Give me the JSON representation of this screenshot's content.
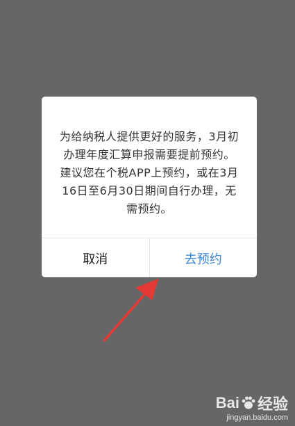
{
  "dialog": {
    "message": "为给纳税人提供更好的服务，3月初办理年度汇算申报需要提前预约。建议您在个税APP上预约，或在3月16日至6月30日期间自行办理，无需预约。",
    "cancel_label": "取消",
    "confirm_label": "去预约"
  },
  "colors": {
    "overlay": "#666666",
    "confirm": "#3b86d8",
    "arrow": "#e53935"
  },
  "watermark": {
    "logo_text_prefix": "Bai",
    "logo_text_suffix": "经验",
    "site": "jingyan.baidu.com"
  }
}
